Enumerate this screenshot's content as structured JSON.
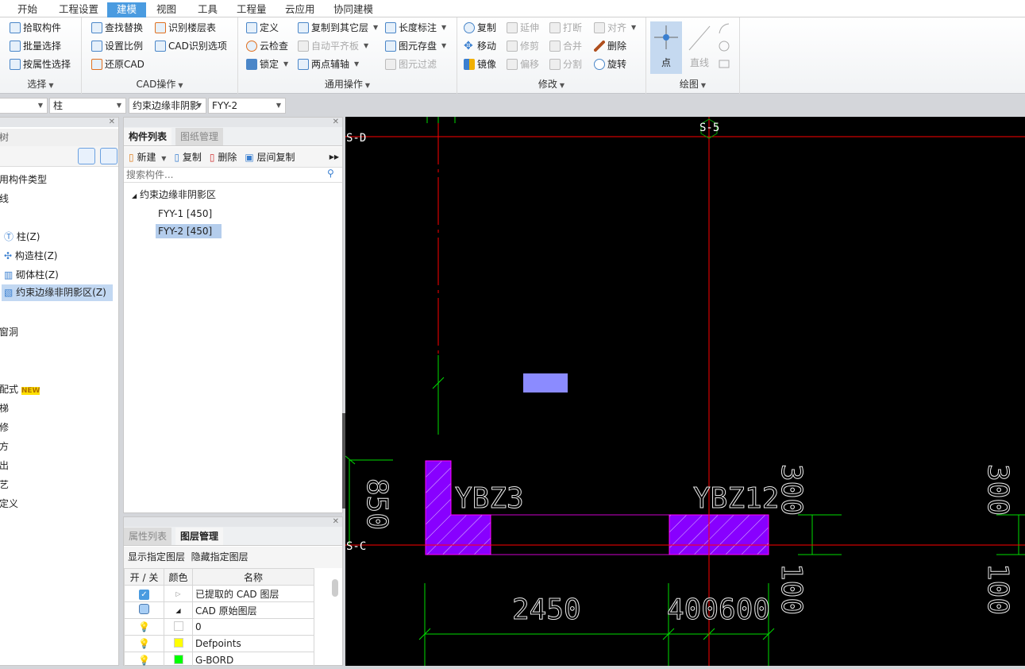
{
  "tabs": [
    "开始",
    "工程设置",
    "建模",
    "视图",
    "工具",
    "工程量",
    "云应用",
    "协同建模"
  ],
  "active_tab": "建模",
  "ribbon": {
    "select": {
      "label": "选择",
      "items": [
        "拾取构件",
        "批量选择",
        "按属性选择"
      ]
    },
    "cad": {
      "label": "CAD操作",
      "items": [
        "查找替换",
        "设置比例",
        "还原CAD",
        "识别楼层表",
        "CAD识别选项"
      ]
    },
    "common": {
      "label": "通用操作",
      "items": [
        "定义",
        "云检查",
        "锁定",
        "复制到其它层",
        "自动平齐板",
        "两点辅轴",
        "长度标注",
        "图元存盘",
        "图元过滤"
      ]
    },
    "modify": {
      "label": "修改",
      "items": [
        "复制",
        "移动",
        "镜像",
        "延伸",
        "修剪",
        "偏移",
        "打断",
        "合并",
        "分割",
        "对齐",
        "删除",
        "旋转"
      ]
    },
    "draw": {
      "label": "绘图",
      "items": [
        "点",
        "直线"
      ]
    }
  },
  "selectors": [
    "",
    "柱",
    "约束边缘非阴影",
    "FYY-2"
  ],
  "left_panel": {
    "title": "树",
    "items": [
      "用构件类型",
      "线",
      "柱(Z)",
      "构造柱(Z)",
      "砌体柱(Z)",
      "约束边缘非阴影区(Z)",
      "窗洞",
      "配式",
      "NEW",
      "梯",
      "修",
      "方",
      "出",
      "艺",
      "定义"
    ]
  },
  "component_panel": {
    "tabs": [
      "构件列表",
      "图纸管理"
    ],
    "toolbar": [
      "新建",
      "复制",
      "删除",
      "层间复制"
    ],
    "search_placeholder": "搜索构件...",
    "tree_root": "约束边缘非阴影区",
    "items": [
      "FYY-1 [450]",
      "FYY-2 [450]"
    ],
    "selected": "FYY-2 [450]"
  },
  "layer_panel": {
    "tabs": [
      "属性列表",
      "图层管理"
    ],
    "actions": [
      "显示指定图层",
      "隐藏指定图层"
    ],
    "columns": [
      "开 / 关",
      "颜色",
      "名称"
    ],
    "rows": [
      {
        "name": "已提取的 CAD 图层",
        "color": ""
      },
      {
        "name": "CAD 原始图层",
        "color": ""
      },
      {
        "name": "0",
        "color": "#ffffff"
      },
      {
        "name": "Defpoints",
        "color": "#ffff00"
      },
      {
        "name": "G-BORD",
        "color": "#00ff00"
      }
    ]
  },
  "cad": {
    "axes": [
      "S-D",
      "S-5",
      "S-C"
    ],
    "labels": [
      "YBZ3",
      "YBZ12"
    ],
    "dims": [
      "850",
      "300",
      "100",
      "300",
      "100",
      "2450",
      "400600"
    ],
    "colors": {
      "axis": "#ff0000",
      "dim": "#00dd00",
      "column": "#8800ff",
      "outline": "#ff00ff",
      "highlight": "#8b8bff"
    }
  }
}
